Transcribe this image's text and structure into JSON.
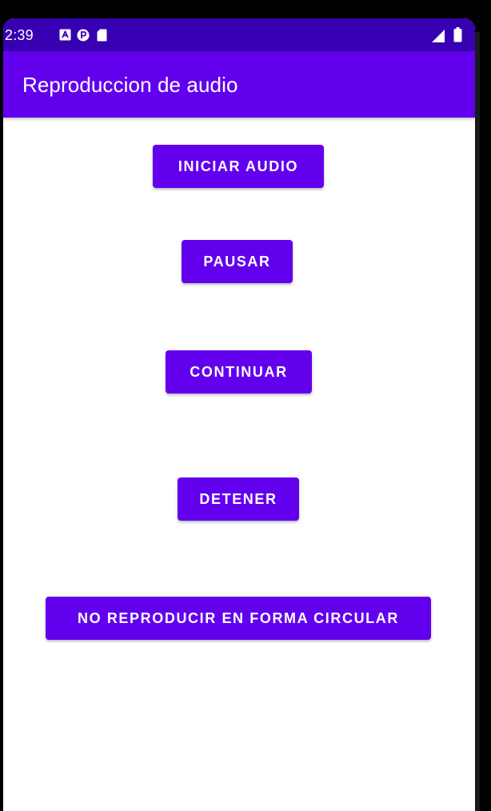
{
  "status_bar": {
    "time": "2:39",
    "icons": [
      "notification-a-icon",
      "notification-p-icon",
      "sd-card-icon",
      "signal-icon",
      "battery-icon"
    ],
    "bg_color": "#3700b3"
  },
  "app_bar": {
    "title": "Reproduccion de audio",
    "bg_color": "#6200ee"
  },
  "buttons": {
    "start": "INICIAR AUDIO",
    "pause": "PAUSAR",
    "continue": "CONTINUAR",
    "stop": "DETENER",
    "loop": "NO REPRODUCIR EN FORMA CIRCULAR"
  },
  "colors": {
    "accent": "#6200ee",
    "background": "#ffffff"
  }
}
